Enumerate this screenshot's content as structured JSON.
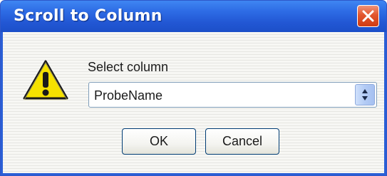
{
  "dialog": {
    "title": "Scroll to Column",
    "close_icon": "close-icon",
    "warning_icon": "warning-icon",
    "label": "Select column",
    "select": {
      "value": "ProbeName",
      "arrow_icon": "updown-arrows-icon"
    },
    "ok_label": "OK",
    "cancel_label": "Cancel"
  },
  "colors": {
    "titlebar": "#2d6be4",
    "close_button": "#e2562e",
    "warning": "#f5e100"
  }
}
